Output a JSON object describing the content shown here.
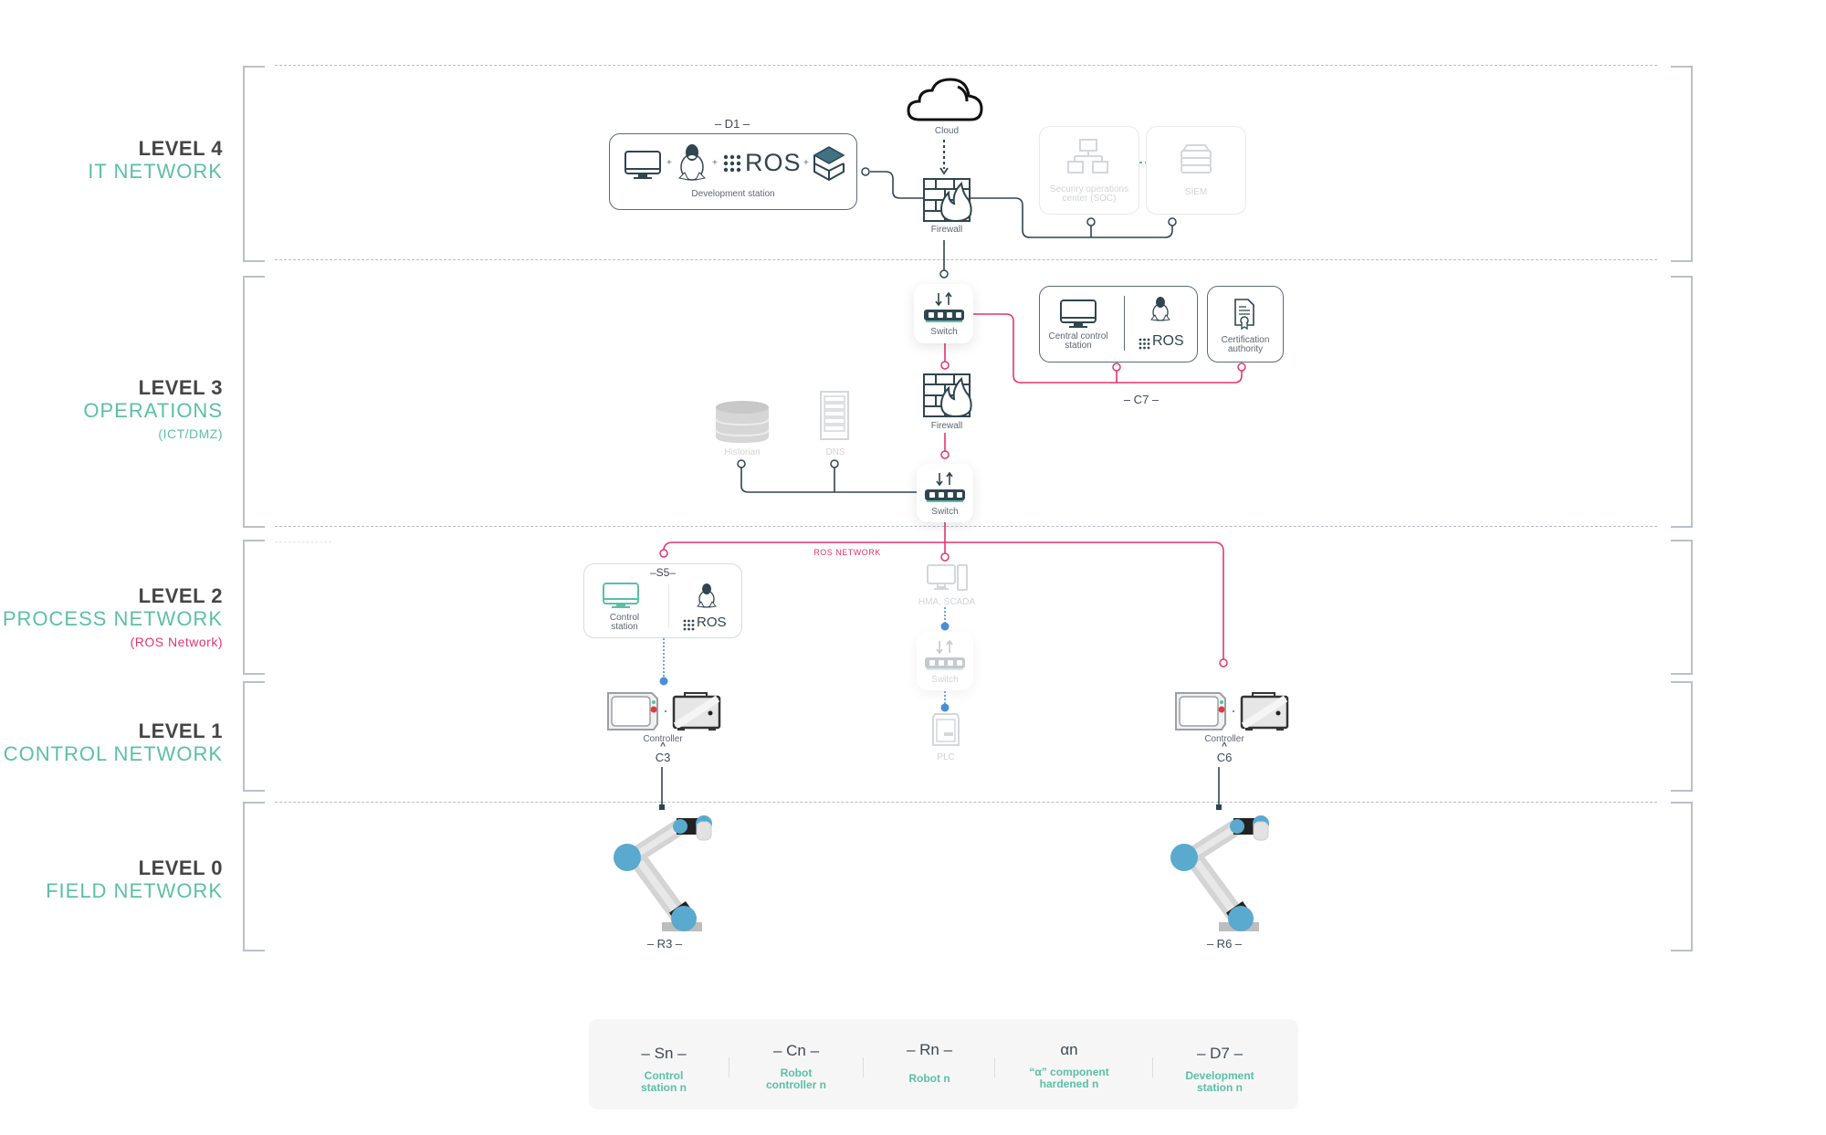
{
  "levels": [
    {
      "title": "LEVEL 4",
      "subtitle": "IT NETWORK",
      "note": ""
    },
    {
      "title": "LEVEL 3",
      "subtitle": "OPERATIONS",
      "note": "(ICT/DMZ)"
    },
    {
      "title": "LEVEL 2",
      "subtitle": "PROCESS NETWORK",
      "note": "(ROS Network)"
    },
    {
      "title": "LEVEL 1",
      "subtitle": "CONTROL NETWORK",
      "note": ""
    },
    {
      "title": "LEVEL 0",
      "subtitle": "FIELD NETWORK",
      "note": ""
    }
  ],
  "nodes": {
    "cloud": {
      "label": "Cloud"
    },
    "dev_station": {
      "tag": "– D1 –",
      "label": "Development station",
      "ros": "ROS",
      "plus": "+"
    },
    "firewall_it": {
      "label": "Firewall"
    },
    "soc": {
      "label": "Securiry operations\ncenter (SOC)"
    },
    "siem": {
      "label": "SIEM"
    },
    "switch_ops_top": {
      "label": "Switch"
    },
    "central_control": {
      "label": "Central control\nstation",
      "ros": "ROS",
      "plus": "+"
    },
    "cert_authority": {
      "label": "Certification\nauthority"
    },
    "c7": {
      "tag": "– C7 –"
    },
    "firewall_ops": {
      "label": "Firewall"
    },
    "historian": {
      "label": "Historian"
    },
    "dns": {
      "label": "DNS"
    },
    "switch_ops_bottom": {
      "label": "Switch"
    },
    "ros_network": {
      "label": "ROS NETWORK"
    },
    "control_station": {
      "tag": "–S5–",
      "label": "Control\nstation",
      "ros": "ROS",
      "plus": "+"
    },
    "hma_scada": {
      "label": "HMA, SCADA"
    },
    "switch_process": {
      "label": "Switch"
    },
    "plc": {
      "label": "PLC"
    },
    "controller_left": {
      "label": "Controller",
      "tag": "C3",
      "hat": "^",
      "plus": "+"
    },
    "controller_right": {
      "label": "Controller",
      "tag": "C6",
      "hat": "^",
      "plus": "+"
    },
    "robot_left": {
      "tag": "– R3 –"
    },
    "robot_right": {
      "tag": "– R6 –"
    }
  },
  "legend": [
    {
      "code": "– Sn –",
      "desc": "Control\nstation n"
    },
    {
      "code": "– Cn –",
      "desc": "Robot\ncontroller n"
    },
    {
      "code": "– Rn –",
      "desc": "Robot n"
    },
    {
      "code": "αn",
      "desc": "“α” component\nhardened n"
    },
    {
      "code": "– D7 –",
      "desc": "Development\nstation n"
    }
  ],
  "colors": {
    "teal": "#5bbfa6",
    "pink": "#e2356f",
    "dark": "#2f4550",
    "blue": "#4a8fd6",
    "robot_blue": "#5aa9cf",
    "faded": "#d3d7da"
  }
}
